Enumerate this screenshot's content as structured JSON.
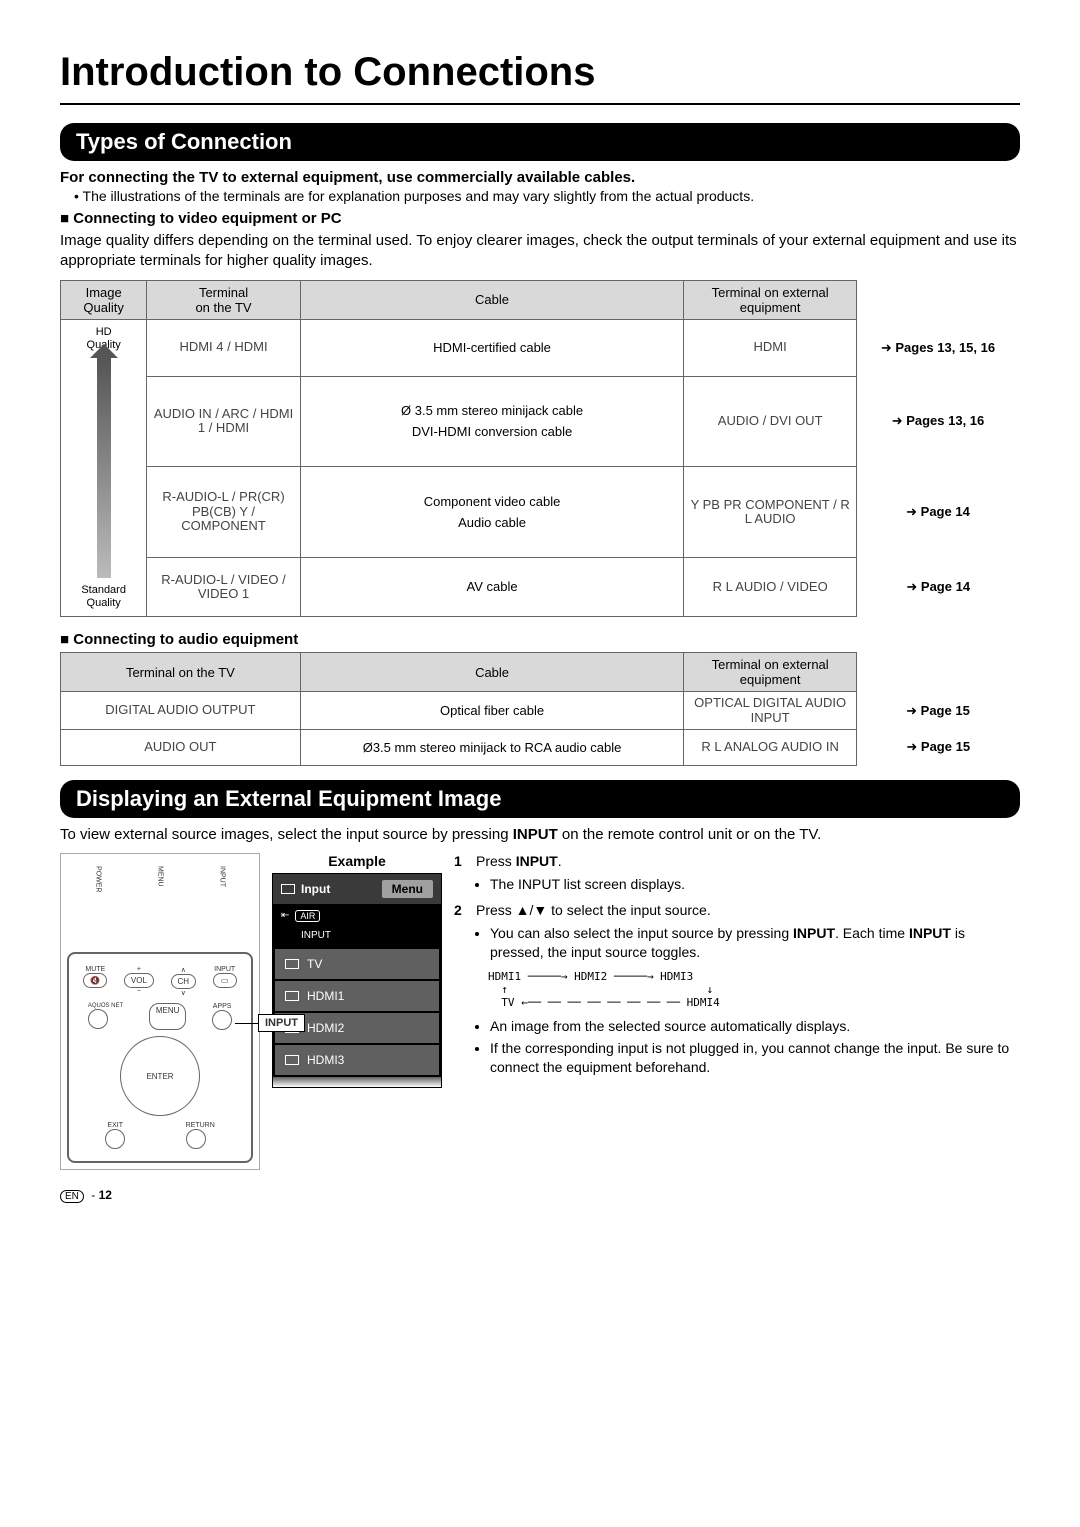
{
  "page_title": "Introduction to Connections",
  "section1": {
    "heading": "Types of Connection",
    "intro_bold": "For connecting the TV to external equipment, use commercially available cables.",
    "intro_bullet": "• The illustrations of the terminals are for explanation purposes and may vary slightly from the actual products.",
    "sub_video": "Connecting to video equipment or PC",
    "desc_video": "Image quality differs depending on the terminal used. To enjoy clearer images, check the output terminals of your external equipment and use its appropriate terminals for higher quality images.",
    "headers": {
      "quality": "Image\nQuality",
      "tv_terminal": "Terminal\non the TV",
      "cable": "Cable",
      "ext_terminal": "Terminal on external\nequipment"
    },
    "quality_hd": "HD\nQuality",
    "quality_std": "Standard\nQuality",
    "rows": [
      {
        "tv_term": "HDMI 4 / HDMI",
        "cable": "HDMI-certified cable",
        "ext_term": "HDMI",
        "pages": "Pages 13, 15, 16"
      },
      {
        "tv_term": "AUDIO IN / ARC / HDMI 1 / HDMI",
        "cable1": "Ø 3.5 mm stereo minijack cable",
        "cable2": "DVI-HDMI conversion cable",
        "ext_term": "AUDIO / DVI OUT",
        "pages": "Pages 13, 16"
      },
      {
        "tv_term": "R-AUDIO-L / PR(CR) PB(CB) Y / COMPONENT",
        "cable1": "Component video cable",
        "cable2": "Audio cable",
        "ext_term": "Y PB PR COMPONENT / R L AUDIO",
        "pages": "Page 14"
      },
      {
        "tv_term": "R-AUDIO-L / VIDEO / VIDEO 1",
        "cable": "AV cable",
        "ext_term": "R L AUDIO / VIDEO",
        "pages": "Page 14"
      }
    ],
    "sub_audio": "Connecting to audio equipment",
    "audio_headers": {
      "tv_terminal": "Terminal on the TV",
      "cable": "Cable",
      "ext_terminal": "Terminal on external\nequipment"
    },
    "audio_rows": [
      {
        "tv_term": "DIGITAL AUDIO OUTPUT",
        "cable": "Optical fiber cable",
        "ext_term": "OPTICAL DIGITAL AUDIO INPUT",
        "pages": "Page 15"
      },
      {
        "tv_term": "AUDIO OUT",
        "cable": "Ø3.5 mm stereo minijack to RCA audio cable",
        "ext_term": "R L ANALOG AUDIO IN",
        "pages": "Page 15"
      }
    ]
  },
  "section2": {
    "heading": "Displaying an External Equipment Image",
    "desc_pre": "To view external source images, select the input source by pressing ",
    "desc_bold": "INPUT",
    "desc_post": " on the remote control unit or on the TV.",
    "example_label": "Example",
    "remote_input_label": "INPUT",
    "remote_labels": {
      "power": "POWER",
      "menu": "MENU",
      "input": "INPUT",
      "mute": "MUTE",
      "vol": "VOL",
      "ch": "CH",
      "aquos": "AQUOS NET",
      "apps": "APPS",
      "enter": "ENTER",
      "exit": "EXIT",
      "return": "RETURN"
    },
    "osd": {
      "title": "Input",
      "menu_btn": "Menu",
      "air": "AIR",
      "input_label": "INPUT",
      "items": [
        "TV",
        "HDMI1",
        "HDMI2",
        "HDMI3"
      ]
    },
    "step1_num": "1",
    "step1_a": "Press ",
    "step1_b": "INPUT",
    "step1_c": ".",
    "step1_bul": "The INPUT list screen displays.",
    "step2_num": "2",
    "step2_a": "Press ▲/▼ to select the input source.",
    "step2_bul1_a": "You can also select the input source by pressing ",
    "step2_bul1_b": "INPUT",
    "step2_bul1_c": ". Each time ",
    "step2_bul1_d": "INPUT",
    "step2_bul1_e": " is pressed, the input source toggles.",
    "toggle_diagram": "HDMI1 ─────→ HDMI2 ─────→ HDMI3\n  ↑                              ↓\n  TV ←── ── ── ── ── ── ── ── HDMI4",
    "step2_bul2": "An image from the selected source automatically displays.",
    "step2_bul3": "If the corresponding input is not plugged in, you cannot change the input. Be sure to connect the equipment beforehand."
  },
  "footer": {
    "lang": "EN",
    "sep": " - ",
    "page": "12"
  }
}
